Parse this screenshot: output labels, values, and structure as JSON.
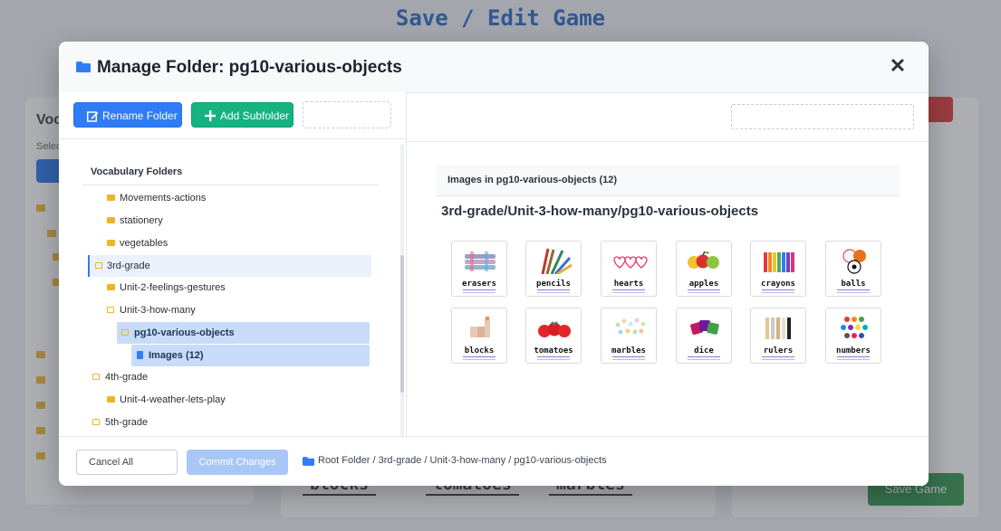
{
  "background": {
    "title": "Save / Edit Game",
    "left_label": "Voca",
    "left_sub": "Selec",
    "right_button": "Save Game",
    "words": [
      "blocks",
      "tomatoes",
      "marbles"
    ]
  },
  "modal": {
    "title": "Manage Folder: pg10-various-objects",
    "close_symbol": "✕",
    "toolbar": {
      "rename_label": "Rename Folder",
      "add_label": "Add Subfolder"
    },
    "tree": {
      "heading": "Vocabulary Folders",
      "rows": [
        {
          "label": "Movements-actions",
          "icon": "folder-icon"
        },
        {
          "label": "stationery",
          "icon": "folder-icon"
        },
        {
          "label": "vegetables",
          "icon": "folder-icon"
        },
        {
          "label": "3rd-grade",
          "icon": "folder-open-icon"
        },
        {
          "label": "Unit-2-feelings-gestures",
          "icon": "folder-icon"
        },
        {
          "label": "Unit-3-how-many",
          "icon": "folder-open-icon"
        },
        {
          "label": "pg10-various-objects",
          "icon": "folder-open-icon"
        },
        {
          "label": "Images (12)",
          "icon": "document-icon"
        },
        {
          "label": "4th-grade",
          "icon": "folder-open-icon"
        },
        {
          "label": "Unit-4-weather-lets-play",
          "icon": "folder-icon"
        },
        {
          "label": "5th-grade",
          "icon": "folder-open-icon"
        }
      ]
    },
    "images_panel": {
      "heading": "Images in pg10-various-objects (12)",
      "path": "3rd-grade/Unit-3-how-many/pg10-various-objects",
      "images": [
        {
          "label": "erasers"
        },
        {
          "label": "pencils"
        },
        {
          "label": "hearts"
        },
        {
          "label": "apples"
        },
        {
          "label": "crayons"
        },
        {
          "label": "balls"
        },
        {
          "label": "blocks"
        },
        {
          "label": "tomatoes"
        },
        {
          "label": "marbles"
        },
        {
          "label": "dice"
        },
        {
          "label": "rulers"
        },
        {
          "label": "numbers"
        }
      ]
    },
    "footer": {
      "cancel_label": "Cancel All",
      "commit_label": "Commit Changes",
      "breadcrumb": "Root Folder / 3rd-grade / Unit-3-how-many / pg10-various-objects"
    }
  },
  "colors": {
    "primary": "#2f7cf6",
    "success": "#14b380",
    "folder": "#f0b429",
    "selected_row": "#c8dcf9"
  }
}
